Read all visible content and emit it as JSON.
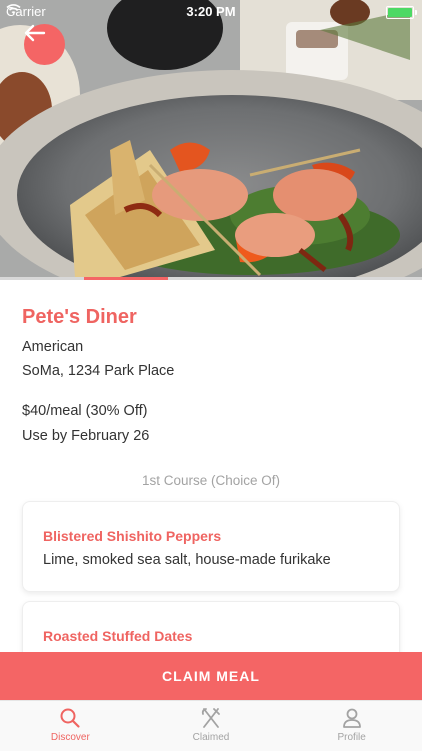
{
  "status_bar": {
    "carrier": "Carrier",
    "time": "3:20 PM"
  },
  "header": {
    "back_icon": "arrow-left-icon",
    "image_progress": 0.2
  },
  "restaurant": {
    "name": "Pete's Diner",
    "cuisine": "American",
    "address": "SoMa, 1234 Park Place",
    "price": "$40/meal (30% Off)",
    "use_by": "Use by February 26"
  },
  "menu": {
    "course_title": "1st Course (Choice Of)",
    "items": [
      {
        "name": "Blistered Shishito Peppers",
        "description": "Lime, smoked sea salt, house-made furikake"
      },
      {
        "name": "Roasted Stuffed Dates",
        "description": ""
      }
    ]
  },
  "actions": {
    "claim_label": "CLAIM MEAL"
  },
  "tabs": [
    {
      "label": "Discover",
      "icon": "search-icon",
      "active": true
    },
    {
      "label": "Claimed",
      "icon": "fork-knife-icon",
      "active": false
    },
    {
      "label": "Profile",
      "icon": "person-icon",
      "active": false
    }
  ],
  "colors": {
    "accent": "#f46565",
    "title": "#ef6461",
    "tab_inactive": "#a3a3a3",
    "battery": "#4cd964"
  }
}
